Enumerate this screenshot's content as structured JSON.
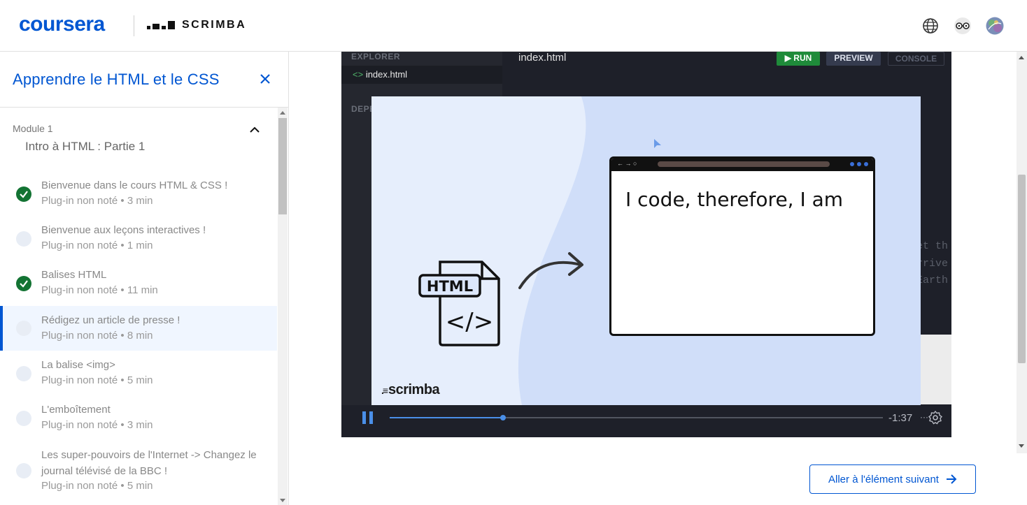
{
  "header": {
    "brand": "coursera",
    "partner": "SCRIMBA"
  },
  "sidebar": {
    "course_title": "Apprendre le HTML et le CSS",
    "module": {
      "label": "Module 1",
      "name": "Intro à HTML : Partie 1"
    },
    "items": [
      {
        "title": "Bienvenue dans le cours HTML & CSS !",
        "meta": "Plug-in non noté • 3 min",
        "completed": true,
        "active": false
      },
      {
        "title": "Bienvenue aux leçons interactives !",
        "meta": "Plug-in non noté • 1 min",
        "completed": false,
        "active": false
      },
      {
        "title": "Balises HTML",
        "meta": "Plug-in non noté • 11 min",
        "completed": true,
        "active": false
      },
      {
        "title": "Rédigez un article de presse !",
        "meta": "Plug-in non noté • 8 min",
        "completed": false,
        "active": true
      },
      {
        "title": "La balise <img>",
        "meta": "Plug-in non noté • 5 min",
        "completed": false,
        "active": false
      },
      {
        "title": "L'emboîtement",
        "meta": "Plug-in non noté • 3 min",
        "completed": false,
        "active": false
      },
      {
        "title": "Les super-pouvoirs de l'Internet -> Changez le journal télévisé de la BBC !",
        "meta": "Plug-in non noté • 5 min",
        "completed": false,
        "active": false
      }
    ]
  },
  "editor": {
    "explorer_label": "EXPLORER",
    "file_name": "index.html",
    "deps_label": "DEPE",
    "tab_name": "index.html",
    "run_label": "▶ RUN",
    "preview_label": "PREVIEW",
    "console_label": "CONSOLE",
    "code_fragments": [
      "et th",
      "rrive",
      "Earth"
    ]
  },
  "slide": {
    "file_badge": "HTML",
    "browser_text": "I code, therefore, I am",
    "watermark": "scrimba"
  },
  "player": {
    "time_remaining": "-1:37",
    "progress": 0.23
  },
  "next_button": {
    "label": "Aller à l'élément suivant"
  },
  "colors": {
    "brand": "#0056d2",
    "completed": "#137333"
  }
}
